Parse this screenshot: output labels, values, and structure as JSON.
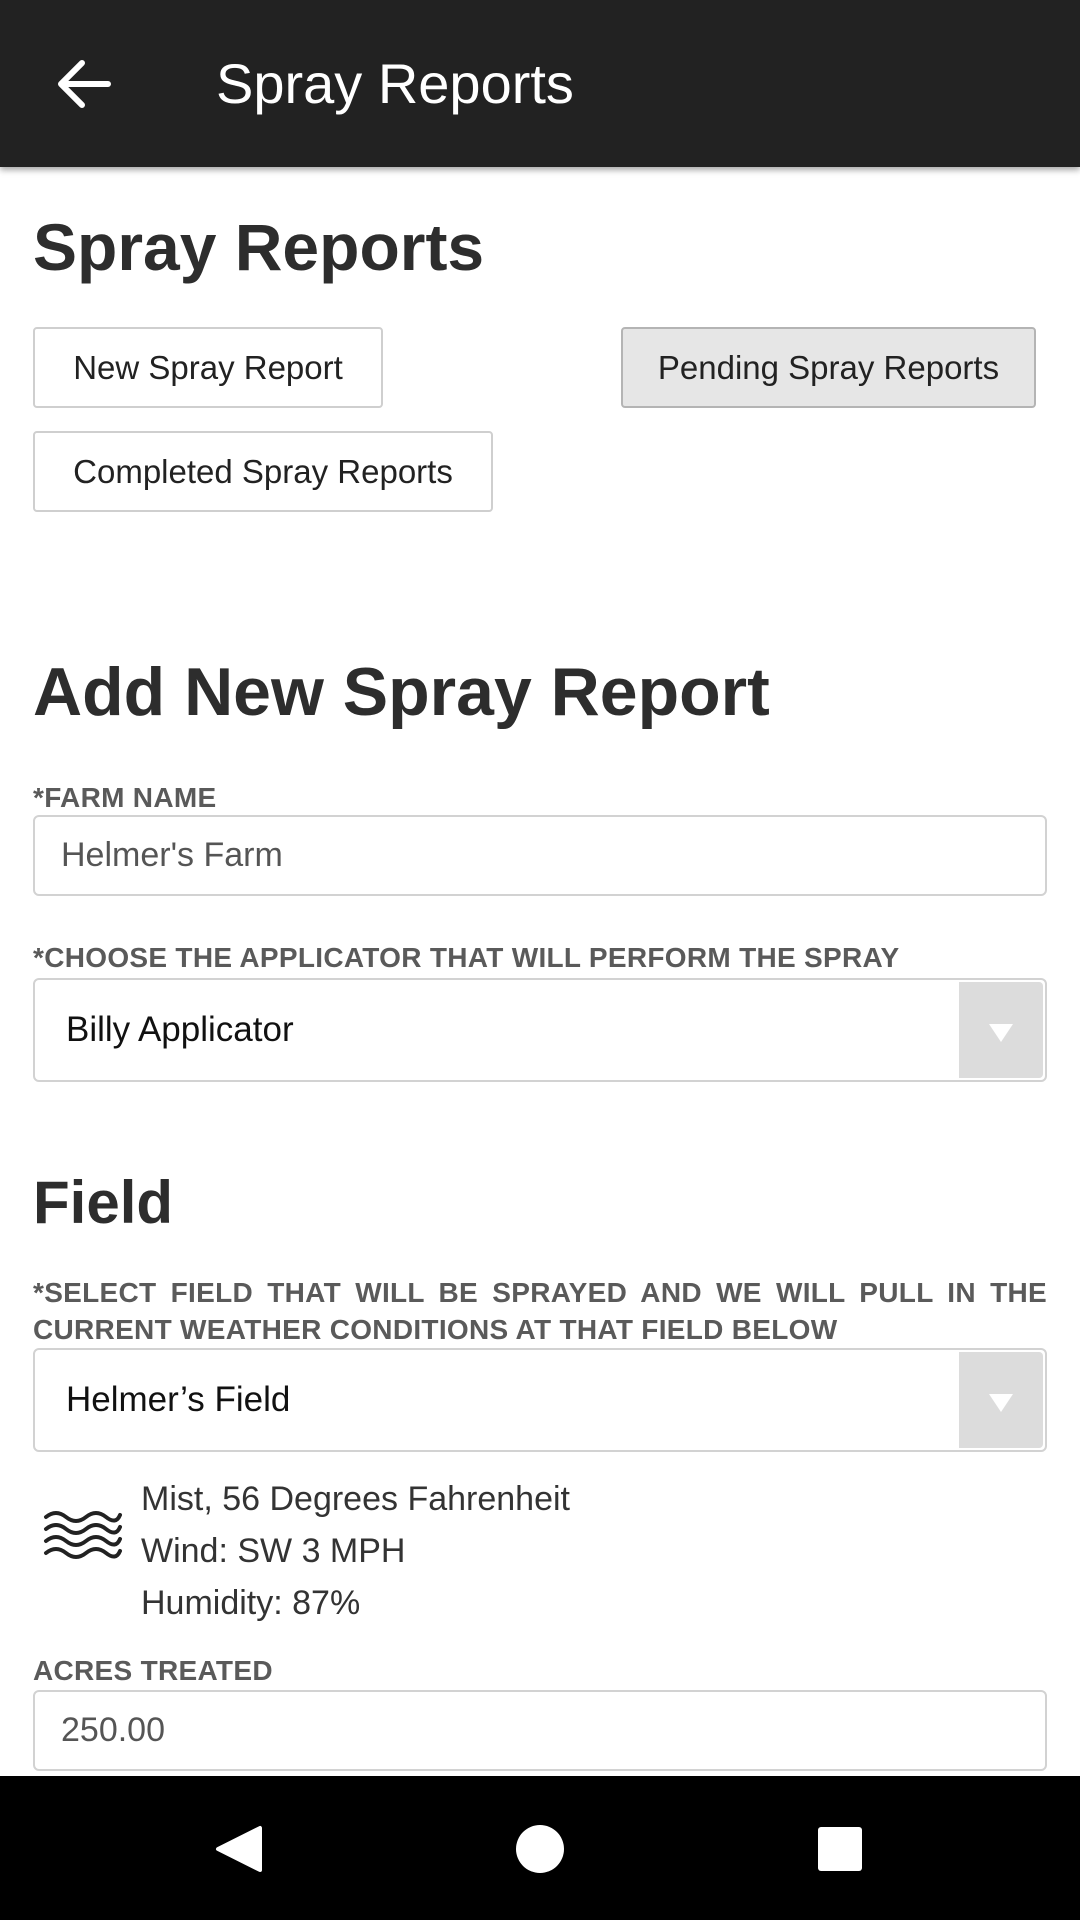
{
  "app_bar": {
    "title": "Spray Reports",
    "back_icon": "arrow-back-icon"
  },
  "page": {
    "heading": "Spray Reports",
    "buttons": {
      "new_report": "New Spray Report",
      "pending_reports": "Pending Spray Reports",
      "completed_reports": "Completed Spray Reports"
    }
  },
  "form": {
    "heading": "Add New Spray Report",
    "farm_name": {
      "label": "*FARM NAME",
      "value": "Helmer's Farm"
    },
    "applicator": {
      "label": "*CHOOSE THE APPLICATOR THAT WILL PERFORM THE SPRAY",
      "selected": "Billy Applicator"
    },
    "field_section": {
      "heading": "Field",
      "label": "*SELECT FIELD THAT WILL BE SPRAYED AND WE WILL PULL IN THE CURRENT WEATHER CONDITIONS AT THAT FIELD BELOW",
      "selected": "Helmer’s Field"
    },
    "weather": {
      "icon": "mist-icon",
      "condition": "Mist, 56 Degrees Fahrenheit",
      "wind": "Wind: SW 3 MPH",
      "humidity": "Humidity: 87%"
    },
    "acres": {
      "label": "ACRES TREATED",
      "value": "250.00"
    }
  },
  "system_nav": {
    "back": "nav-back-icon",
    "home": "nav-home-icon",
    "recents": "nav-recents-icon"
  },
  "colors": {
    "app_bar": "#222222",
    "nav_bar": "#000000",
    "pending_button_bg": "#e6e6e6",
    "label_text": "#5a5a5a"
  }
}
